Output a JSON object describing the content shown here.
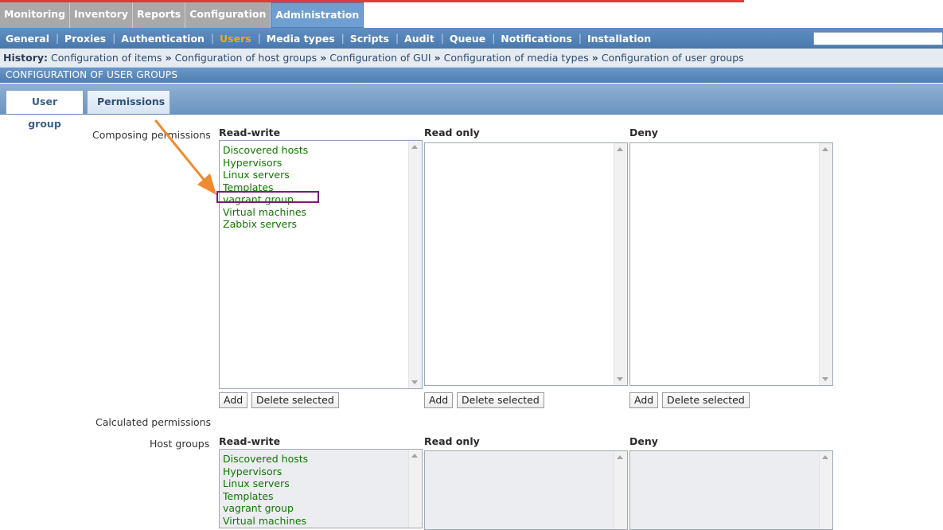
{
  "main_menu": [
    {
      "label": "Monitoring",
      "active": false
    },
    {
      "label": "Inventory",
      "active": false
    },
    {
      "label": "Reports",
      "active": false
    },
    {
      "label": "Configuration",
      "active": false
    },
    {
      "label": "Administration",
      "active": true
    }
  ],
  "sub_menu": [
    {
      "label": "General",
      "active": false
    },
    {
      "label": "Proxies",
      "active": false
    },
    {
      "label": "Authentication",
      "active": false
    },
    {
      "label": "Users",
      "active": true
    },
    {
      "label": "Media types",
      "active": false
    },
    {
      "label": "Scripts",
      "active": false
    },
    {
      "label": "Audit",
      "active": false
    },
    {
      "label": "Queue",
      "active": false
    },
    {
      "label": "Notifications",
      "active": false
    },
    {
      "label": "Installation",
      "active": false
    }
  ],
  "search": {
    "value": "",
    "placeholder": ""
  },
  "history": {
    "label": "History:",
    "links": [
      "Configuration of items",
      "Configuration of host groups",
      "Configuration of GUI",
      "Configuration of media types",
      "Configuration of user groups"
    ],
    "separator": "»"
  },
  "page_title": "CONFIGURATION OF USER GROUPS",
  "tabs": [
    {
      "label": "User group"
    },
    {
      "label": "Permissions"
    }
  ],
  "composing": {
    "label": "Composing permissions",
    "columns": [
      {
        "title": "Read-write",
        "items": [
          "Discovered hosts",
          "Hypervisors",
          "Linux servers",
          "Templates",
          "vagrant group",
          "Virtual machines",
          "Zabbix servers"
        ]
      },
      {
        "title": "Read only",
        "items": []
      },
      {
        "title": "Deny",
        "items": []
      }
    ],
    "add_label": "Add",
    "delete_label": "Delete selected"
  },
  "calculated": {
    "label": "Calculated permissions",
    "hostgroups_label": "Host groups",
    "columns": [
      {
        "title": "Read-write",
        "items": [
          "Discovered hosts",
          "Hypervisors",
          "Linux servers",
          "Templates",
          "vagrant group",
          "Virtual machines"
        ]
      },
      {
        "title": "Read only",
        "items": []
      },
      {
        "title": "Deny",
        "items": []
      }
    ]
  },
  "colors": {
    "accent": "#f3a81a",
    "active_menu": "#6f9fd1",
    "host_text": "#117700",
    "highlight": "#7a1a7a",
    "arrow": "#f08a30"
  }
}
